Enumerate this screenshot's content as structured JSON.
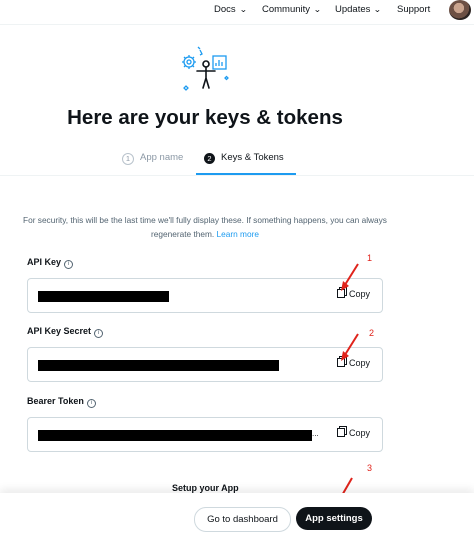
{
  "nav": {
    "items": [
      {
        "label": "Docs",
        "has_dropdown": true
      },
      {
        "label": "Community",
        "has_dropdown": true
      },
      {
        "label": "Updates",
        "has_dropdown": true
      },
      {
        "label": "Support",
        "has_dropdown": false
      }
    ]
  },
  "page": {
    "title": "Here are your keys & tokens",
    "hero_icon": "person-with-gears-chart-icon"
  },
  "steps": [
    {
      "number": "1",
      "label": "App name",
      "active": false
    },
    {
      "number": "2",
      "label": "Keys & Tokens",
      "active": true
    }
  ],
  "notice": {
    "text": "For security, this will be the last time we'll fully display these. If something happens, you can always regenerate them.",
    "link": "Learn more"
  },
  "keys": [
    {
      "label": "API Key",
      "copy_label": "Copy",
      "value_redacted": true
    },
    {
      "label": "API Key Secret",
      "copy_label": "Copy",
      "value_redacted": true
    },
    {
      "label": "Bearer Token",
      "copy_label": "Copy",
      "value_redacted": true,
      "truncated": "..."
    }
  ],
  "annotations": [
    "1",
    "2",
    "3"
  ],
  "footer": {
    "setup_label": "Setup your App",
    "dashboard_button": "Go to dashboard",
    "settings_button": "App settings"
  },
  "colors": {
    "accent": "#1d9bf0",
    "text": "#0f1419",
    "muted": "#536471",
    "annotation": "#e0231b",
    "primary_button": "#0f1419"
  }
}
